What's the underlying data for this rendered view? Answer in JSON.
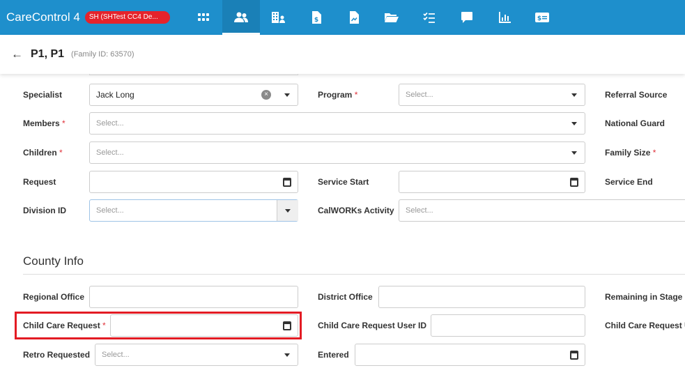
{
  "app": {
    "title": "CareControl 4",
    "tenant": "SH (SHTest CC4 De...",
    "accent": "#1e8fcc",
    "nav": [
      {
        "icon": "grid-icon"
      },
      {
        "icon": "people-icon",
        "active": true
      },
      {
        "icon": "building-people-icon"
      },
      {
        "icon": "document-dollar-icon"
      },
      {
        "icon": "document-chart-icon"
      },
      {
        "icon": "folder-open-icon"
      },
      {
        "icon": "checklist-icon"
      },
      {
        "icon": "chat-icon"
      },
      {
        "icon": "bar-chart-icon"
      },
      {
        "icon": "payment-icon"
      }
    ]
  },
  "header": {
    "name": "P1, P1",
    "family_id": "(Family ID: 63570)"
  },
  "form": {
    "specialist": {
      "label": "Specialist",
      "value": "Jack Long"
    },
    "program": {
      "label": "Program",
      "placeholder": "Select..."
    },
    "referral_source": {
      "label": "Referral Source"
    },
    "members": {
      "label": "Members",
      "placeholder": "Select..."
    },
    "national_guard": {
      "label": "National Guard"
    },
    "children": {
      "label": "Children",
      "placeholder": "Select..."
    },
    "family_size": {
      "label": "Family Size"
    },
    "request": {
      "label": "Request"
    },
    "service_start": {
      "label": "Service Start"
    },
    "service_end": {
      "label": "Service End"
    },
    "division_id": {
      "label": "Division ID",
      "placeholder": "Select..."
    },
    "calworks_activity": {
      "label": "CalWORKs Activity",
      "placeholder": "Select..."
    }
  },
  "county": {
    "title": "County Info",
    "regional_office": {
      "label": "Regional Office"
    },
    "district_office": {
      "label": "District Office"
    },
    "remaining_in_stage": {
      "label": "Remaining in Stage"
    },
    "child_care_request": {
      "label": "Child Care Request"
    },
    "child_care_request_user_id": {
      "label": "Child Care Request User ID"
    },
    "child_care_request_u": {
      "label": "Child Care Request U"
    },
    "retro_requested": {
      "label": "Retro Requested",
      "placeholder": "Select..."
    },
    "entered": {
      "label": "Entered"
    }
  },
  "required_mark": "*"
}
